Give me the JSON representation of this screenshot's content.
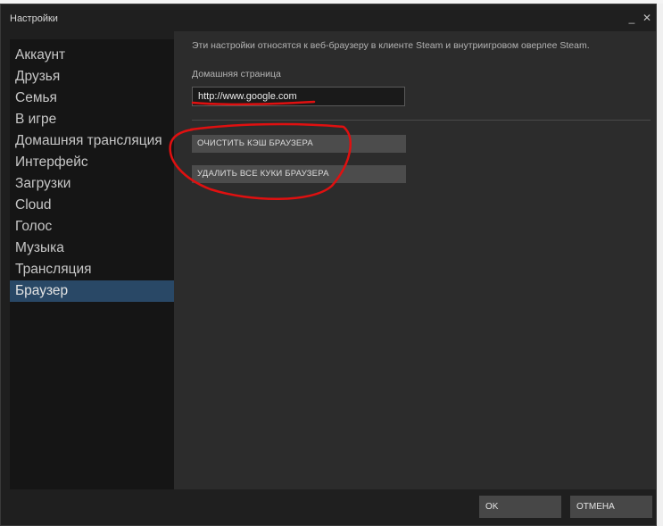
{
  "window": {
    "title": "Настройки",
    "minimize_glyph": "_",
    "close_glyph": "✕"
  },
  "sidebar": {
    "items": [
      {
        "label": "Аккаунт"
      },
      {
        "label": "Друзья"
      },
      {
        "label": "Семья"
      },
      {
        "label": "В игре"
      },
      {
        "label": "Домашняя трансляция"
      },
      {
        "label": "Интерфейс"
      },
      {
        "label": "Загрузки"
      },
      {
        "label": "Cloud"
      },
      {
        "label": "Голос"
      },
      {
        "label": "Музыка"
      },
      {
        "label": "Трансляция"
      },
      {
        "label": "Браузер",
        "active": true
      }
    ]
  },
  "browser_settings": {
    "description": "Эти настройки относятся к веб-браузеру в клиенте Steam и внутриигровом оверлее Steam.",
    "home_label": "Домашняя страница",
    "home_value": "http://www.google.com",
    "clear_cache_label": "ОЧИСТИТЬ КЭШ БРАУЗЕРА",
    "delete_cookies_label": "УДАЛИТЬ ВСЕ КУКИ БРАУЗЕРА"
  },
  "footer": {
    "ok_label": "OK",
    "cancel_label": "ОТМЕНА"
  },
  "colors": {
    "window_bg": "#1f1f1f",
    "sidebar_bg": "#151515",
    "content_bg": "#2c2c2c",
    "active_item": "#294866",
    "annotation_red": "#e01010"
  }
}
